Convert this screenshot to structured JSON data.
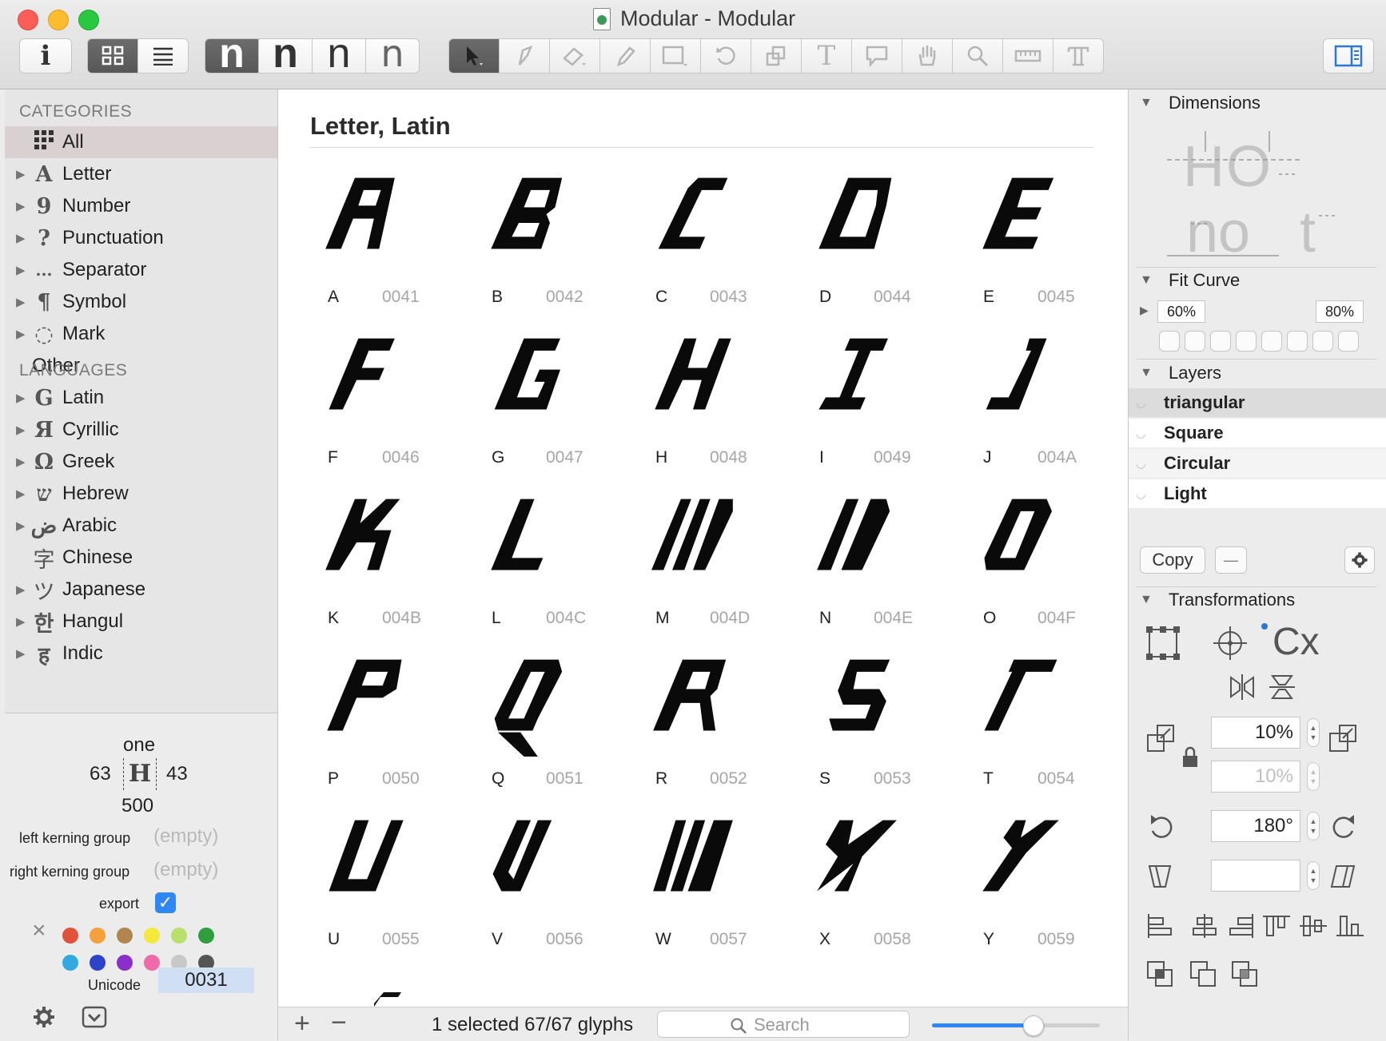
{
  "window": {
    "title": "Modular - Modular"
  },
  "toolbar": {
    "info_icon": "info-icon",
    "view_grid_icon": "grid-view-icon",
    "view_list_icon": "list-view-icon",
    "preview_glyph": "n",
    "tools": [
      "select-tool-icon",
      "draw-tool-icon",
      "eraser-tool-icon",
      "pencil-tool-icon",
      "rectangle-tool-icon",
      "rotate-tool-icon",
      "scale-tool-icon",
      "text-tool-icon",
      "annotation-tool-icon",
      "hand-tool-icon",
      "zoom-tool-icon",
      "measure-tool-icon",
      "type-tool-icon"
    ],
    "sidebar_toggle_icon": "sidebar-toggle-icon"
  },
  "sidebar": {
    "categories_header": "CATEGORIES",
    "categories": [
      {
        "label": "All",
        "icon": "all-grid-icon",
        "glyph": "",
        "selected": true
      },
      {
        "label": "Letter",
        "icon": "letter-icon",
        "glyph": "A"
      },
      {
        "label": "Number",
        "icon": "number-icon",
        "glyph": "9"
      },
      {
        "label": "Punctuation",
        "icon": "punctuation-icon",
        "glyph": "?"
      },
      {
        "label": "Separator",
        "icon": "separator-icon",
        "glyph": "..."
      },
      {
        "label": "Symbol",
        "icon": "symbol-icon",
        "glyph": "¶"
      },
      {
        "label": "Mark",
        "icon": "mark-icon",
        "glyph": "◌"
      },
      {
        "label": "Other",
        "icon": "",
        "glyph": ""
      }
    ],
    "languages_header": "LANGUAGES",
    "languages": [
      {
        "label": "Latin",
        "glyph": "G",
        "icon": "latin-icon"
      },
      {
        "label": "Cyrillic",
        "glyph": "Я",
        "icon": "cyrillic-icon"
      },
      {
        "label": "Greek",
        "glyph": "Ω",
        "icon": "greek-icon"
      },
      {
        "label": "Hebrew",
        "glyph": "ש",
        "icon": "hebrew-icon"
      },
      {
        "label": "Arabic",
        "glyph": "ض",
        "icon": "arabic-icon"
      },
      {
        "label": "Chinese",
        "glyph": "字",
        "icon": "chinese-icon"
      },
      {
        "label": "Japanese",
        "glyph": "ツ",
        "icon": "japanese-icon"
      },
      {
        "label": "Hangul",
        "glyph": "한",
        "icon": "hangul-icon"
      },
      {
        "label": "Indic",
        "glyph": "ह",
        "icon": "indic-icon"
      }
    ],
    "info": {
      "glyph_name": "one",
      "lsb": "63",
      "rsb": "43",
      "width": "500",
      "left_kerning_label": "left kerning group",
      "left_kerning_value": "(empty)",
      "right_kerning_label": "right kerning group",
      "right_kerning_value": "(empty)",
      "export_label": "export",
      "export_checked": true,
      "colors": [
        "#e0533a",
        "#f5a03a",
        "#b0864e",
        "#f4e83a",
        "#b8e06a",
        "#2e9e3e",
        "#34a9e0",
        "#2d43c8",
        "#8a2fc9",
        "#ee6aa8",
        "#c8c8c8",
        "#555555"
      ],
      "unicode_label": "Unicode",
      "unicode_value": "0031"
    }
  },
  "main": {
    "section_title": "Letter, Latin",
    "glyphs": [
      {
        "ch": "A",
        "code": "0041"
      },
      {
        "ch": "B",
        "code": "0042"
      },
      {
        "ch": "C",
        "code": "0043"
      },
      {
        "ch": "D",
        "code": "0044"
      },
      {
        "ch": "E",
        "code": "0045"
      },
      {
        "ch": "F",
        "code": "0046"
      },
      {
        "ch": "G",
        "code": "0047"
      },
      {
        "ch": "H",
        "code": "0048"
      },
      {
        "ch": "I",
        "code": "0049"
      },
      {
        "ch": "J",
        "code": "004A"
      },
      {
        "ch": "K",
        "code": "004B"
      },
      {
        "ch": "L",
        "code": "004C"
      },
      {
        "ch": "M",
        "code": "004D"
      },
      {
        "ch": "N",
        "code": "004E"
      },
      {
        "ch": "O",
        "code": "004F"
      },
      {
        "ch": "P",
        "code": "0050"
      },
      {
        "ch": "Q",
        "code": "0051"
      },
      {
        "ch": "R",
        "code": "0052"
      },
      {
        "ch": "S",
        "code": "0053"
      },
      {
        "ch": "T",
        "code": "0054"
      },
      {
        "ch": "U",
        "code": "0055"
      },
      {
        "ch": "V",
        "code": "0056"
      },
      {
        "ch": "W",
        "code": "0057"
      },
      {
        "ch": "X",
        "code": "0058"
      },
      {
        "ch": "Y",
        "code": "0059"
      }
    ],
    "status": "1 selected 67/67 glyphs",
    "search_placeholder": "Search",
    "zoom_level": 0.6
  },
  "inspector": {
    "dimensions_label": "Dimensions",
    "dimensions_sample_upper": "HO",
    "dimensions_sample_lower": "no",
    "dimensions_sample_t": "t",
    "fit_curve_label": "Fit Curve",
    "fit_curve_min": "60%",
    "fit_curve_max": "80%",
    "layers_label": "Layers",
    "layers": [
      {
        "name": "triangular",
        "selected": true
      },
      {
        "name": "Square"
      },
      {
        "name": "Circular"
      },
      {
        "name": "Light"
      }
    ],
    "copy_label": "Copy",
    "minus_label": "—",
    "transformations_label": "Transformations",
    "transform_sample": "Cx",
    "scale_x": "10%",
    "scale_y": "10%",
    "rotate": "180°",
    "slant": ""
  }
}
